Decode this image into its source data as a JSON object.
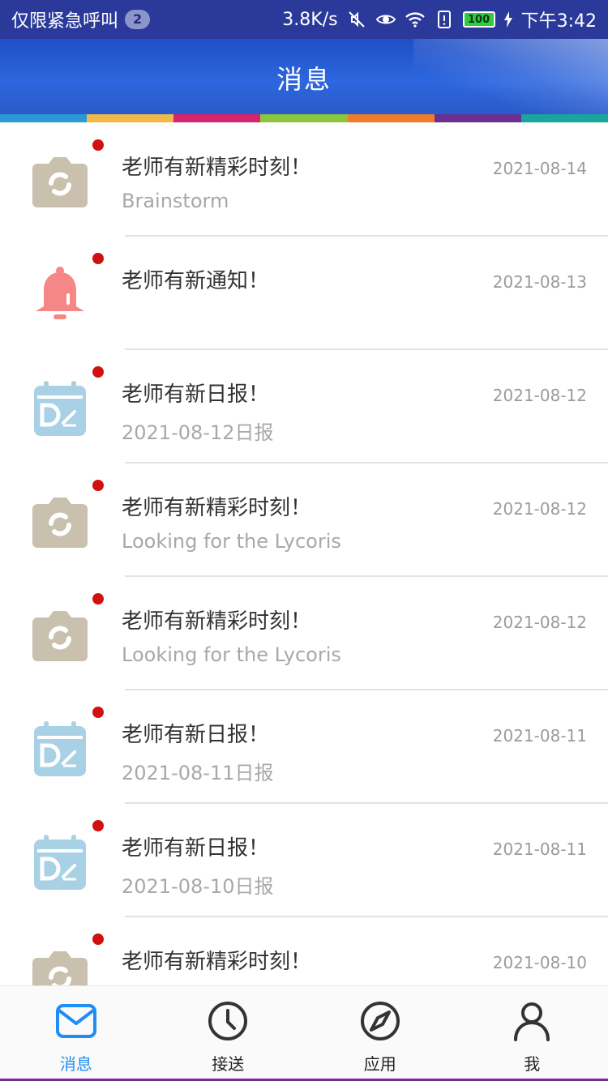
{
  "status_bar": {
    "carrier_text": "仅限紧急呼叫",
    "notification_count": "2",
    "speed": "3.8K/s",
    "battery": "100",
    "time": "下午3:42",
    "icons": [
      "mute-icon",
      "eye-icon",
      "wifi-icon",
      "sim-alert-icon",
      "battery-icon",
      "charging-icon"
    ]
  },
  "header": {
    "title": "消息",
    "strip_colors": [
      "#2a9ad5",
      "#f0b94a",
      "#d6246e",
      "#8cc63e",
      "#f07c2a",
      "#6a2f91",
      "#19a59c"
    ]
  },
  "messages": [
    {
      "icon": "camera-icon",
      "title": "老师有新精彩时刻！",
      "subtitle": "Brainstorm",
      "date": "2021-08-14"
    },
    {
      "icon": "bell-icon",
      "title": "老师有新通知！",
      "subtitle": "",
      "date": "2021-08-13"
    },
    {
      "icon": "calendar-icon",
      "title": "老师有新日报！",
      "subtitle": "2021-08-12日报",
      "date": "2021-08-12"
    },
    {
      "icon": "camera-icon",
      "title": "老师有新精彩时刻！",
      "subtitle": "Looking for the Lycoris",
      "date": "2021-08-12"
    },
    {
      "icon": "camera-icon",
      "title": "老师有新精彩时刻！",
      "subtitle": "Looking for the Lycoris",
      "date": "2021-08-12"
    },
    {
      "icon": "calendar-icon",
      "title": "老师有新日报！",
      "subtitle": "2021-08-11日报",
      "date": "2021-08-11"
    },
    {
      "icon": "calendar-icon",
      "title": "老师有新日报！",
      "subtitle": "2021-08-10日报",
      "date": "2021-08-11"
    },
    {
      "icon": "camera-icon",
      "title": "老师有新精彩时刻！",
      "subtitle": "",
      "date": "2021-08-10"
    }
  ],
  "tabs": [
    {
      "label": "消息",
      "icon": "envelope-icon",
      "active": true
    },
    {
      "label": "接送",
      "icon": "clock-icon",
      "active": false
    },
    {
      "label": "应用",
      "icon": "compass-icon",
      "active": false
    },
    {
      "label": "我",
      "icon": "user-icon",
      "active": false
    }
  ],
  "colors": {
    "status_bar": "#2b3a9a",
    "header": "#2d66de",
    "unread_dot": "#d0110f",
    "camera_icon": "#c9c0ae",
    "bell_icon": "#f58886",
    "calendar_icon": "#a9d1e6",
    "tab_active": "#1e8df5",
    "tab_inactive": "#333333"
  }
}
